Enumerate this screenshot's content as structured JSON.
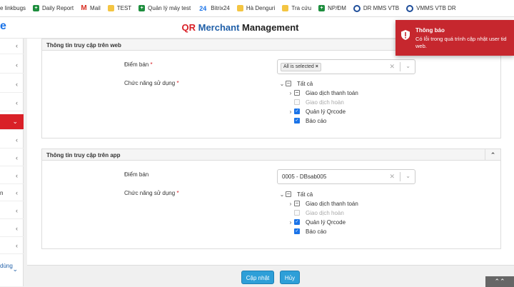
{
  "bookmarks": [
    {
      "label": "e linkbugs",
      "icon": "none"
    },
    {
      "label": "Daily Report",
      "icon": "sheet"
    },
    {
      "label": "Mail",
      "icon": "mail"
    },
    {
      "label": "TEST",
      "icon": "folder"
    },
    {
      "label": "Quản lý máy test",
      "icon": "sheet"
    },
    {
      "label": "Bitrix24",
      "icon": "b24"
    },
    {
      "label": "Hà Denguri",
      "icon": "folder"
    },
    {
      "label": "Tra cứu",
      "icon": "folder"
    },
    {
      "label": "NP/ĐM",
      "icon": "sheet"
    },
    {
      "label": "DR MMS VTB",
      "icon": "vtb"
    },
    {
      "label": "VMMS VTB DR",
      "icon": "vtb"
    }
  ],
  "header": {
    "logo_fragment": "e",
    "title_qr": "QR",
    "title_merchant": "Merchant",
    "title_management": "Management"
  },
  "sidebar": {
    "partial_text_1": "n",
    "partial_text_2": "dùng"
  },
  "web_section": {
    "title": "Thông tin truy cập trên web",
    "store_label": "Điểm bán",
    "store_required": "*",
    "store_tag": "All is selected",
    "func_label": "Chức năng sử dụng",
    "func_required": "*",
    "tree": {
      "root": "Tất cả",
      "items": [
        "Giao dịch thanh toán",
        "Giao dịch hoàn",
        "Quản lý Qrcode",
        "Báo cáo"
      ]
    }
  },
  "app_section": {
    "title": "Thông tin truy cập trên app",
    "store_label": "Điểm bán",
    "store_value": "0005 - DBsab005",
    "func_label": "Chức năng sử dụng",
    "func_required": "*",
    "tree": {
      "root": "Tất cả",
      "items": [
        "Giao dịch thanh toán",
        "Giao dịch hoàn",
        "Quản lý Qrcode",
        "Báo cáo"
      ]
    }
  },
  "footer": {
    "update_label": "Cập nhật",
    "cancel_label": "Hủy"
  },
  "toast": {
    "title": "Thông báo",
    "message": "Có lỗi trong quá trình cập nhật user tid web."
  },
  "colors": {
    "brand_red": "#d92027",
    "brand_blue": "#1f5fa8",
    "button_blue": "#2e9fd8",
    "toast_red": "#c6272e"
  }
}
